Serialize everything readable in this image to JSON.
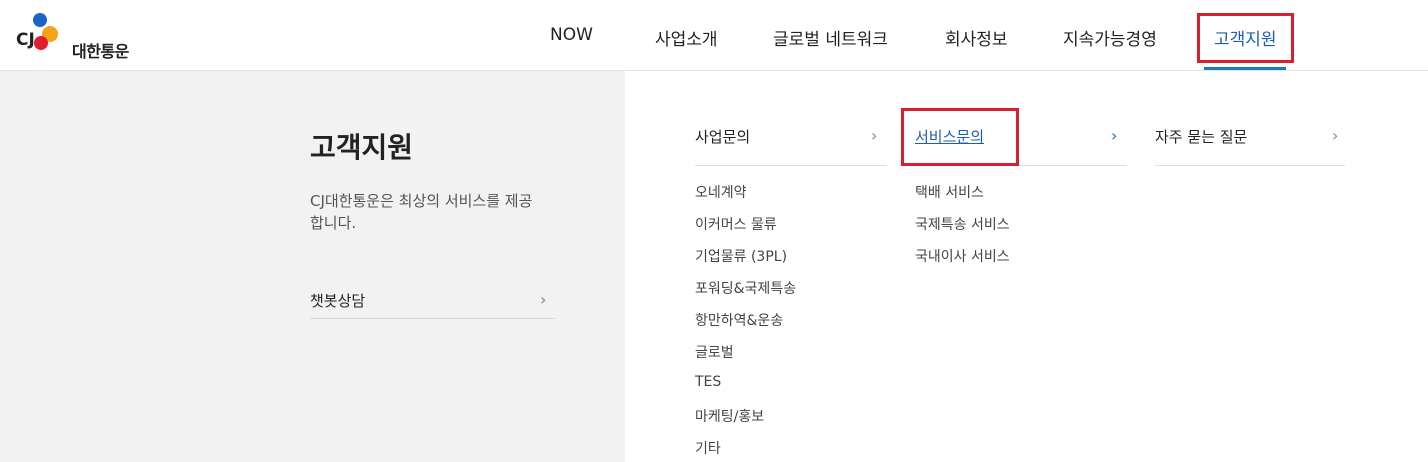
{
  "brand": {
    "name": "대한통운",
    "logo_text": "CJ"
  },
  "gnb": [
    {
      "label": "NOW"
    },
    {
      "label": "사업소개"
    },
    {
      "label": "글로벌 네트워크"
    },
    {
      "label": "회사정보"
    },
    {
      "label": "지속가능경영"
    },
    {
      "label": "고객지원"
    }
  ],
  "side": {
    "title": "고객지원",
    "description": "CJ대한통운은 최상의 서비스를 제공합니다.",
    "link_label": "챗봇상담"
  },
  "columns": [
    {
      "title": "사업문의",
      "items": [
        "오네계약",
        "이커머스 물류",
        "기업물류 (3PL)",
        "포워딩&국제특송",
        "항만하역&운송",
        "글로벌",
        "TES",
        "마케팅/홍보",
        "기타"
      ]
    },
    {
      "title": "서비스문의",
      "items": [
        "택배 서비스",
        "국제특송 서비스",
        "국내이사 서비스"
      ]
    },
    {
      "title": "자주 묻는 질문",
      "items": []
    }
  ],
  "chevron": "›",
  "colors": {
    "accent": "#1b5fb0",
    "highlight": "#d6202f",
    "panel_bg": "#f2f2f2"
  }
}
